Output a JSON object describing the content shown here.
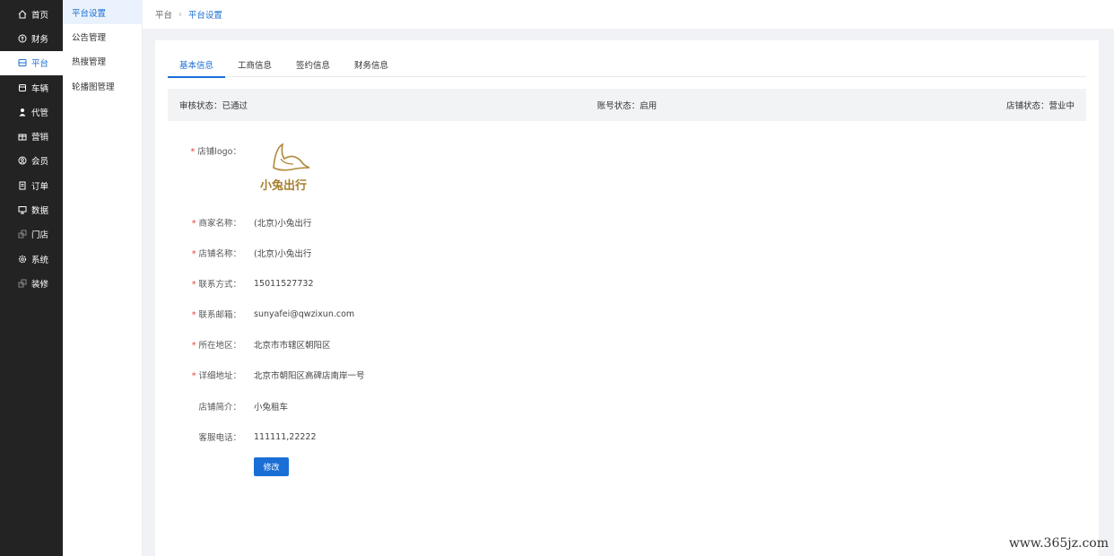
{
  "sidebar": {
    "items": [
      {
        "label": "首页",
        "icon": "home-icon"
      },
      {
        "label": "财务",
        "icon": "shield-icon"
      },
      {
        "label": "平台",
        "icon": "platform-icon",
        "active": true
      },
      {
        "label": "车辆",
        "icon": "calendar-icon"
      },
      {
        "label": "代管",
        "icon": "user-icon"
      },
      {
        "label": "营销",
        "icon": "gift-icon"
      },
      {
        "label": "会员",
        "icon": "member-icon"
      },
      {
        "label": "订单",
        "icon": "order-icon"
      },
      {
        "label": "数据",
        "icon": "monitor-icon"
      },
      {
        "label": "门店",
        "icon": "store-icon"
      },
      {
        "label": "系统",
        "icon": "gear-icon"
      },
      {
        "label": "装修",
        "icon": "decorate-icon"
      }
    ]
  },
  "submenu": {
    "items": [
      {
        "label": "平台设置",
        "active": true
      },
      {
        "label": "公告管理"
      },
      {
        "label": "热搜管理"
      },
      {
        "label": "轮播图管理"
      }
    ]
  },
  "breadcrumb": {
    "parent": "平台",
    "current": "平台设置"
  },
  "tabs": [
    {
      "label": "基本信息",
      "active": true
    },
    {
      "label": "工商信息"
    },
    {
      "label": "签约信息"
    },
    {
      "label": "财务信息"
    }
  ],
  "status": {
    "review": "审核状态：已通过",
    "account": "账号状态：启用",
    "store": "店铺状态：营业中"
  },
  "form": {
    "logo_label": "店铺logo：",
    "logo_text": "小兔出行",
    "fields": [
      {
        "label": "商家名称：",
        "value": "(北京)小兔出行",
        "required": true
      },
      {
        "label": "店铺名称：",
        "value": "(北京)小兔出行",
        "required": true
      },
      {
        "label": "联系方式：",
        "value": "15011527732",
        "required": true
      },
      {
        "label": "联系邮箱：",
        "value": "sunyafei@qwzixun.com",
        "required": true
      },
      {
        "label": "所在地区：",
        "value": "北京市市辖区朝阳区",
        "required": true
      },
      {
        "label": "详细地址：",
        "value": "北京市朝阳区高碑店南岸一号",
        "required": true
      },
      {
        "label": "店铺简介：",
        "value": "小兔租车",
        "required": false
      },
      {
        "label": "客服电话：",
        "value": "111111,22222",
        "required": false
      }
    ],
    "edit_button": "修改"
  },
  "watermark": "www.365jz.com",
  "colors": {
    "accent": "#1a6fd6",
    "sidebar_bg": "#232323",
    "required_star": "#e5443b",
    "logo_gold": "#b08a3a"
  }
}
